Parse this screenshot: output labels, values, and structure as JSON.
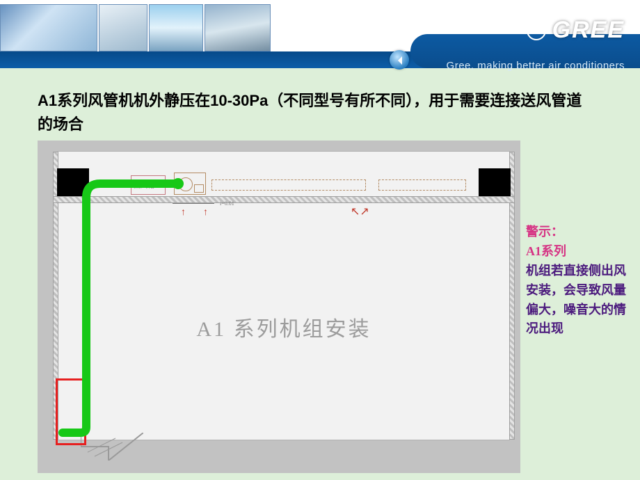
{
  "brand": {
    "name": "GREE",
    "tagline": "Gree, making better air conditioners"
  },
  "heading": "A1系列风管机机外静压在10-30Pa（不同型号有所不同），用于需要连接送风管道的场合",
  "diagram": {
    "return_box_label": "回风箱",
    "slope_label": "i=0.01",
    "center_title": "A1 系列机组安装"
  },
  "warning": {
    "title": "警示：",
    "series": "A1系列",
    "body": "机组若直接侧出风安装，会导致风量偏大，噪音大的情况出现"
  }
}
